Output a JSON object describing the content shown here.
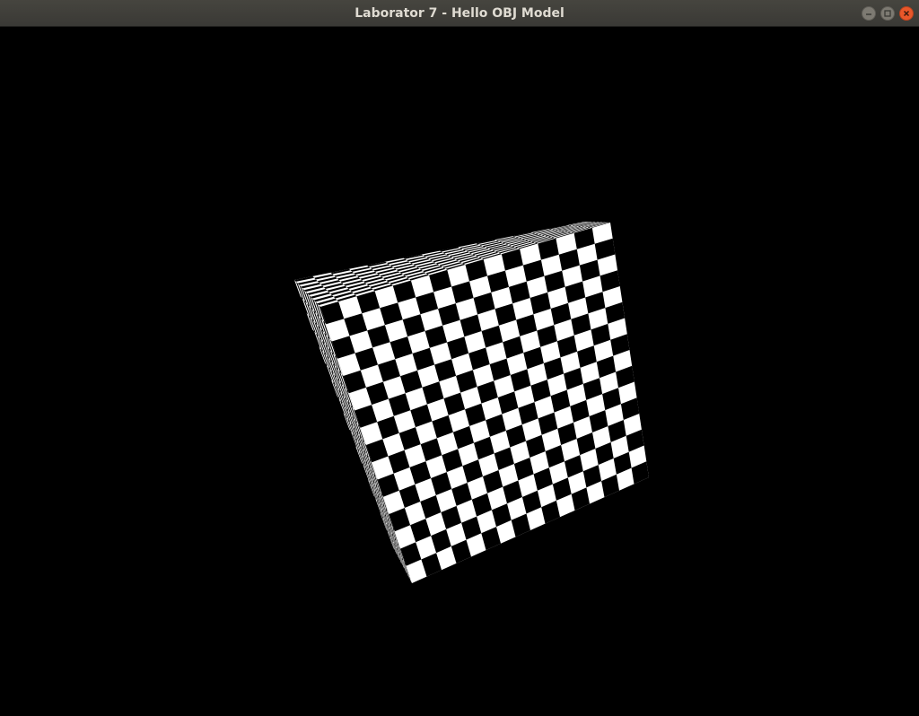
{
  "window": {
    "title": "Laborator 7 - Hello OBJ Model",
    "controls": [
      "minimize",
      "maximize",
      "close"
    ]
  },
  "scene": {
    "background_color": "#000000",
    "model": "checkerboard-textured cube",
    "checker_colors": [
      "#000000",
      "#ffffff"
    ],
    "close_button_color": "#e9572a"
  }
}
